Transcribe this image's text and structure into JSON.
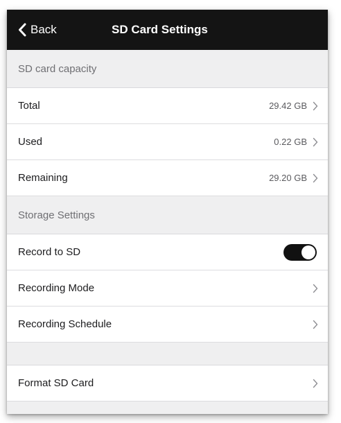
{
  "nav": {
    "back_label": "Back",
    "title": "SD Card Settings"
  },
  "capacity_section": {
    "header": "SD card capacity",
    "rows": [
      {
        "label": "Total",
        "value": "29.42 GB"
      },
      {
        "label": "Used",
        "value": "0.22 GB"
      },
      {
        "label": "Remaining",
        "value": "29.20 GB"
      }
    ]
  },
  "storage_section": {
    "header": "Storage Settings",
    "record_to_sd": {
      "label": "Record to SD",
      "enabled": true
    },
    "recording_mode": {
      "label": "Recording Mode"
    },
    "recording_schedule": {
      "label": "Recording Schedule"
    }
  },
  "format_section": {
    "format_sd_card": {
      "label": "Format SD Card"
    }
  },
  "colors": {
    "nav_background": "#141414",
    "toggle_on": "#111111",
    "group_background": "#efeff0"
  }
}
